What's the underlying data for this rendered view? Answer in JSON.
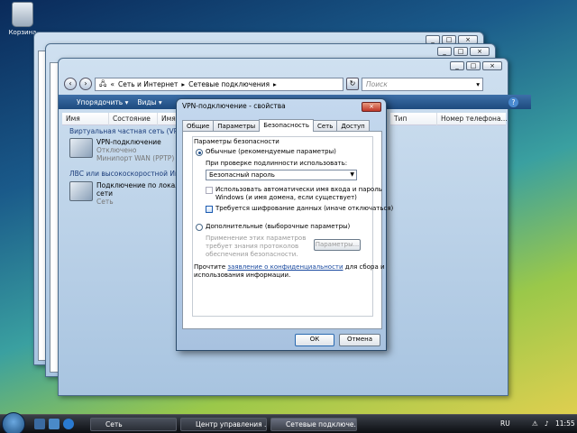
{
  "desktop": {
    "recycle_bin_label": "Корзина"
  },
  "explorer": {
    "breadcrumb": [
      "Сеть и Интернет",
      "Сетевые подключения"
    ],
    "search_placeholder": "Поиск",
    "toolbar": {
      "organize": "Упорядочить",
      "views": "Виды"
    },
    "columns_left": [
      "Имя",
      "Состояние",
      "Имя"
    ],
    "columns_right": [
      "Тип",
      "Номер телефона..."
    ],
    "group_vpn": "Виртуальная частная сеть (VPN) (1)",
    "vpn_item": {
      "name": "VPN-подключение",
      "status": "Отключено",
      "device": "Минипорт WAN (PPTP)"
    },
    "group_lan": "ЛВС или высокоскоростной Интерн...",
    "lan_item": {
      "name_line1": "Подключение по локальн...",
      "name_line2": "сети",
      "status": "Сеть"
    }
  },
  "dialog": {
    "title": "VPN-подключение - свойства",
    "tabs": [
      "Общие",
      "Параметры",
      "Безопасность",
      "Сеть",
      "Доступ"
    ],
    "active_tab": "Безопасность",
    "group_title": "Параметры безопасности",
    "radio_typical": "Обычные (рекомендуемые параметры)",
    "verify_label": "При проверке подлинности использовать:",
    "verify_value": "Безопасный пароль",
    "auto_login_line1": "Использовать автоматически имя входа и пароль",
    "auto_login_line2": "Windows (и имя домена, если существует)",
    "require_encryption": "Требуется шифрование данных (иначе отключаться)",
    "radio_advanced": "Дополнительные (выборочные параметры)",
    "advanced_desc_line1": "Применение этих параметров",
    "advanced_desc_line2": "требует знания протоколов",
    "advanced_desc_line3": "обеспечения безопасности.",
    "params_button": "Параметры...",
    "privacy_prefix": "Прочтите",
    "privacy_link": "заявление о конфиденциальности",
    "privacy_suffix": "для сбора и",
    "privacy_line2": "использования информации.",
    "ok": "ОК",
    "cancel": "Отмена",
    "typical_selected": true,
    "require_encryption_checked": true
  },
  "taskbar": {
    "items": [
      "Сеть",
      "Центр управления ...",
      "Сетевые подключе..."
    ],
    "language": "RU",
    "clock": "11:55"
  }
}
